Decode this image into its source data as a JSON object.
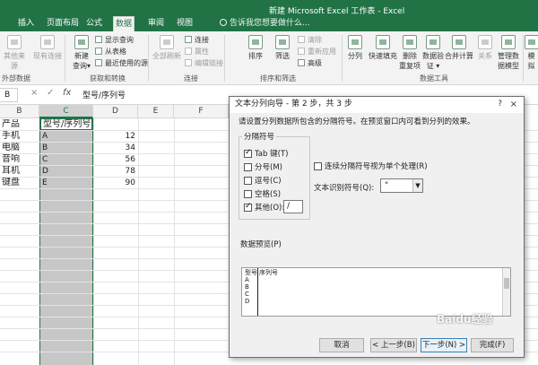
{
  "window": {
    "title": "新建 Microsoft Excel 工作表 - Excel"
  },
  "tabs": [
    "插入",
    "页面布局",
    "公式",
    "数据",
    "审阅",
    "视图"
  ],
  "active_tab": "数据",
  "tell_me": "告诉我您想要做什么...",
  "ribbon": {
    "get_external": {
      "btn1": "其他来源",
      "btn2": "现有连接",
      "group": "外部数据"
    },
    "get_transform": {
      "new_query": "新建",
      "new_query2": "查询▾",
      "show_queries": "显示查询",
      "from_table": "从表格",
      "recent": "最近使用的源",
      "group": "获取和转换"
    },
    "connections": {
      "refresh_all": "全部刷新",
      "connections": "连接",
      "properties": "属性",
      "edit_links": "编辑链接",
      "group": "连接"
    },
    "sort_filter": {
      "sort": "排序",
      "filter": "筛选",
      "clear": "清除",
      "reapply": "重新应用",
      "advanced": "高级",
      "group": "排序和筛选"
    },
    "data_tools": {
      "split": "分列",
      "flash_fill": "快速填充",
      "remove_dup": "删除",
      "remove_dup2": "重复项",
      "validation": "数据验",
      "validation2": "证 ▾",
      "consolidate": "合并计算",
      "relations": "关系",
      "manage_model": "管理数",
      "manage_model2": "据模型",
      "group": "数据工具"
    },
    "forecast": {
      "what_if": "模拟"
    }
  },
  "formula_bar": {
    "name_box": "B",
    "cancel": "×",
    "enter": "✓",
    "fx": "fx",
    "content": "型号/序列号"
  },
  "columns": [
    "B",
    "C",
    "D",
    "E",
    "F"
  ],
  "selected_column": "C",
  "rows": [
    {
      "b": "产品",
      "c": "型号/序列号",
      "d": ""
    },
    {
      "b": "手机",
      "c": "A",
      "d": "12"
    },
    {
      "b": "电脑",
      "c": "B",
      "d": "34"
    },
    {
      "b": "音响",
      "c": "C",
      "d": "56"
    },
    {
      "b": "耳机",
      "c": "D",
      "d": "78"
    },
    {
      "b": "键盘",
      "c": "E",
      "d": "90"
    }
  ],
  "dialog": {
    "title": "文本分列向导 - 第 2 步，共 3 步",
    "help": "?",
    "close": "×",
    "instruction": "请设置分列数据所包含的分隔符号。在预览窗口内可看到分列的效果。",
    "delim_group": "分隔符号",
    "delimiters": [
      {
        "label": "Tab 键(T)",
        "checked": true
      },
      {
        "label": "分号(M)",
        "checked": false
      },
      {
        "label": "逗号(C)",
        "checked": false
      },
      {
        "label": "空格(S)",
        "checked": false
      },
      {
        "label": "其他(O):",
        "checked": true
      }
    ],
    "other_value": "/",
    "consecutive": {
      "label": "连续分隔符号视为单个处理(R)",
      "checked": false
    },
    "qualifier_label": "文本识别符号(Q):",
    "qualifier_value": "\"",
    "preview_label": "数据预览(P)",
    "preview_rows": [
      [
        "型号",
        "序列号"
      ],
      [
        "A",
        ""
      ],
      [
        "B",
        ""
      ],
      [
        "C",
        ""
      ],
      [
        "D",
        ""
      ]
    ],
    "buttons": {
      "cancel": "取消",
      "back": "< 上一步(B)",
      "next": "下一步(N) >",
      "finish": "完成(F)"
    }
  },
  "watermark": "Baidu经验"
}
